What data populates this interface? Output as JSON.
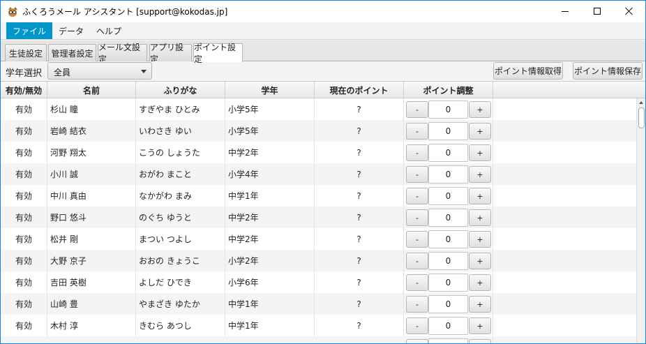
{
  "window": {
    "title": "ふくろうメール アシスタント [support@kokodas.jp]",
    "icon": "owl-icon"
  },
  "menu": {
    "items": [
      {
        "label": "ファイル"
      },
      {
        "label": "データ"
      },
      {
        "label": "ヘルプ"
      }
    ]
  },
  "tabs": [
    {
      "label": "生徒設定"
    },
    {
      "label": "管理者設定"
    },
    {
      "label": "メール文設定"
    },
    {
      "label": "アプリ設定"
    },
    {
      "label": "ポイント設定"
    }
  ],
  "active_tab": "ポイント設定",
  "toolbar": {
    "grade_label": "学年選択",
    "grade_value": "全員",
    "fetch_label": "ポイント情報取得",
    "save_label": "ポイント情報保存"
  },
  "table": {
    "columns": [
      "有効/無効",
      "名前",
      "ふりがな",
      "学年",
      "現在のポイント",
      "ポイント調整"
    ],
    "minus_label": "-",
    "plus_label": "+",
    "rows": [
      {
        "status": "有効",
        "name": "杉山 瞳",
        "furigana": "すぎやま ひとみ",
        "grade": "小学5年",
        "points": "?",
        "adjust": "0"
      },
      {
        "status": "有効",
        "name": "岩崎 結衣",
        "furigana": "いわさき ゆい",
        "grade": "小学5年",
        "points": "?",
        "adjust": "0"
      },
      {
        "status": "有効",
        "name": "河野 翔太",
        "furigana": "こうの しょうた",
        "grade": "中学2年",
        "points": "?",
        "adjust": "0"
      },
      {
        "status": "有効",
        "name": "小川 誠",
        "furigana": "おがわ まこと",
        "grade": "小学4年",
        "points": "?",
        "adjust": "0"
      },
      {
        "status": "有効",
        "name": "中川 真由",
        "furigana": "なかがわ まみ",
        "grade": "中学1年",
        "points": "?",
        "adjust": "0"
      },
      {
        "status": "有効",
        "name": "野口 悠斗",
        "furigana": "のぐち ゆうと",
        "grade": "中学2年",
        "points": "?",
        "adjust": "0"
      },
      {
        "status": "有効",
        "name": "松井 剛",
        "furigana": "まつい つよし",
        "grade": "中学2年",
        "points": "?",
        "adjust": "0"
      },
      {
        "status": "有効",
        "name": "大野 京子",
        "furigana": "おおの きょうこ",
        "grade": "小学2年",
        "points": "?",
        "adjust": "0"
      },
      {
        "status": "有効",
        "name": "吉田 英樹",
        "furigana": "よしだ ひでき",
        "grade": "小学6年",
        "points": "?",
        "adjust": "0"
      },
      {
        "status": "有効",
        "name": "山崎 豊",
        "furigana": "やまざき ゆたか",
        "grade": "中学1年",
        "points": "?",
        "adjust": "0"
      },
      {
        "status": "有効",
        "name": "木村 淳",
        "furigana": "きむら あつし",
        "grade": "中学1年",
        "points": "?",
        "adjust": "0"
      }
    ]
  },
  "colors": {
    "menu_active": "#0096c9",
    "window_border": "#1883d7",
    "row_alt": "#f4f4f4"
  }
}
